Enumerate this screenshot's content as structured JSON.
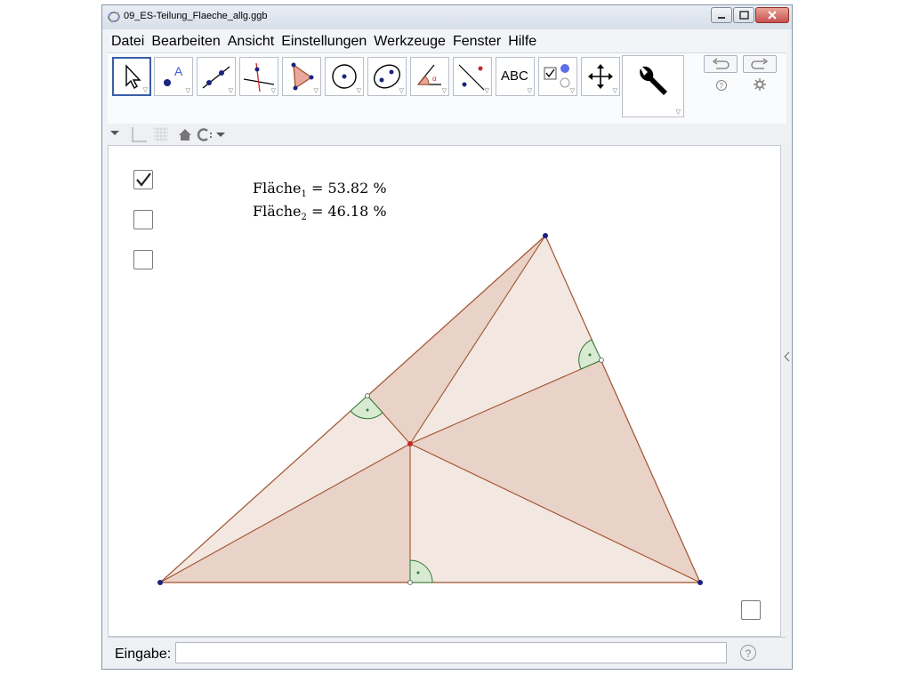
{
  "window": {
    "title": "09_ES-Teilung_Flaeche_allg.ggb"
  },
  "menu": {
    "items": [
      "Datei",
      "Bearbeiten",
      "Ansicht",
      "Einstellungen",
      "Werkzeuge",
      "Fenster",
      "Hilfe"
    ]
  },
  "toolbar": {
    "abc_label": "ABC",
    "tools": [
      "move-tool",
      "point-tool",
      "line-tool",
      "perpendicular-tool",
      "polygon-tool",
      "circle-tool",
      "conic-tool",
      "angle-tool",
      "reflect-tool",
      "text-tool",
      "checkbox-tool",
      "move-view-tool"
    ]
  },
  "graphics": {
    "labels": {
      "area1_name": "Fläche",
      "area1_sub": "1",
      "area1_value": "= 53.82 %",
      "area2_name": "Fläche",
      "area2_sub": "2",
      "area2_value": "= 46.18 %"
    },
    "checkboxes": [
      {
        "checked": true
      },
      {
        "checked": false
      },
      {
        "checked": false
      },
      {
        "checked": false
      }
    ],
    "colors": {
      "triangle_edge": "#a0522d",
      "fill_light": "#f2e6e0",
      "fill_dark": "#e8d0c4",
      "right_angle": "#2e7d32",
      "vertex": "#1a237e",
      "center": "#c62828"
    }
  },
  "inputbar": {
    "label": "Eingabe:",
    "value": ""
  }
}
